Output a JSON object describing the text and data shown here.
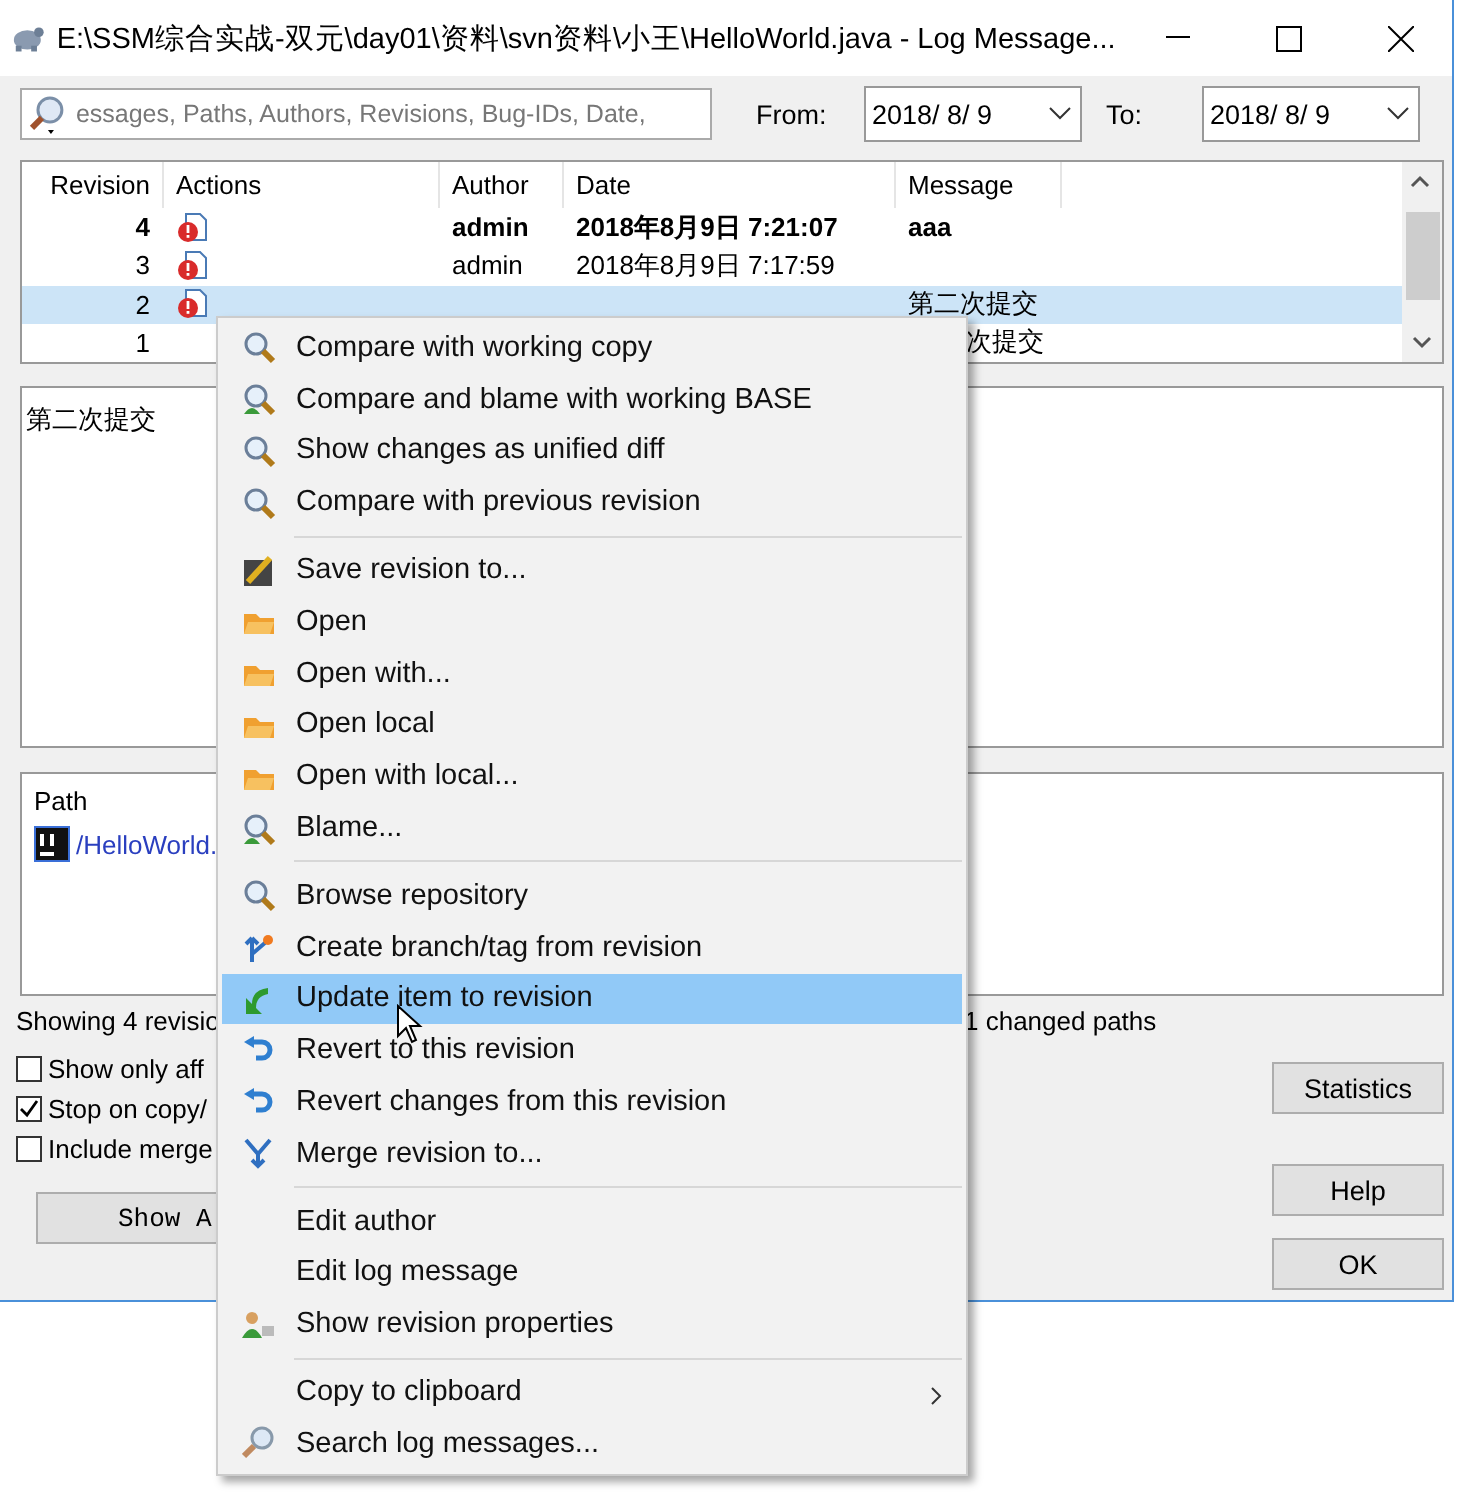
{
  "window": {
    "title": "E:\\SSM综合实战-双元\\day01\\资料\\svn资料\\小王\\HelloWorld.java - Log Message..."
  },
  "filter": {
    "placeholder": "essages, Paths, Authors, Revisions, Bug-IDs, Date,",
    "from_label": "From:",
    "from_value": "2018/ 8/ 9",
    "to_label": "To:",
    "to_value": "2018/ 8/ 9"
  },
  "log": {
    "columns": [
      "Revision",
      "Actions",
      "Author",
      "Date",
      "Message"
    ],
    "rows": [
      {
        "revision": "4",
        "actions": true,
        "author": "admin",
        "date": "2018年8月9日 7:21:07",
        "message": "aaa",
        "current": true,
        "selected": false
      },
      {
        "revision": "3",
        "actions": true,
        "author": "admin",
        "date": "2018年8月9日 7:17:59",
        "current": false,
        "selected": false
      },
      {
        "revision": "2",
        "actions": true,
        "message": "第二次提交",
        "current": false,
        "selected": true
      },
      {
        "revision": "1",
        "actions": false,
        "message_tail": "次提交",
        "current": false,
        "selected": false
      }
    ]
  },
  "message_box": {
    "text": "第二次提交"
  },
  "paths": {
    "header": "Path",
    "items": [
      {
        "path": "/HelloWorld."
      }
    ]
  },
  "status": {
    "left": "Showing 4 revisio",
    "right": "1 changed paths"
  },
  "options": [
    {
      "label": "Show only aff",
      "checked": false
    },
    {
      "label": "Stop on copy/",
      "checked": true
    },
    {
      "label": "Include merge",
      "checked": false
    }
  ],
  "buttons": {
    "show_all": "Show A",
    "statistics": "Statistics",
    "help": "Help",
    "ok": "OK"
  },
  "context_menu": {
    "groups": [
      [
        {
          "label": "Compare with working copy",
          "kind": "compare",
          "selected": false
        },
        {
          "label": "Compare and blame with working BASE",
          "kind": "blame",
          "selected": false
        },
        {
          "label": "Show changes as unified diff",
          "kind": "compare",
          "selected": false
        },
        {
          "label": "Compare with previous revision",
          "kind": "compare",
          "selected": false
        }
      ],
      [
        {
          "label": "Save revision to...",
          "kind": "save",
          "selected": false
        },
        {
          "label": "Open",
          "kind": "open",
          "selected": false
        },
        {
          "label": "Open with...",
          "kind": "open",
          "selected": false
        },
        {
          "label": "Open local",
          "kind": "open",
          "selected": false
        },
        {
          "label": "Open with local...",
          "kind": "open",
          "selected": false
        },
        {
          "label": "Blame...",
          "kind": "blame",
          "selected": false
        }
      ],
      [
        {
          "label": "Browse repository",
          "kind": "browse",
          "selected": false
        },
        {
          "label": "Create branch/tag from revision",
          "kind": "branch",
          "selected": false
        },
        {
          "label": "Update item to revision",
          "kind": "update",
          "selected": true
        },
        {
          "label": "Revert to this revision",
          "kind": "revert",
          "selected": false
        },
        {
          "label": "Revert changes from this revision",
          "kind": "revert",
          "selected": false
        },
        {
          "label": "Merge revision to...",
          "kind": "merge",
          "selected": false
        }
      ],
      [
        {
          "label": "Edit author",
          "kind": "plain",
          "selected": false
        },
        {
          "label": "Edit log message",
          "kind": "plain",
          "selected": false
        },
        {
          "label": "Show revision properties",
          "kind": "props",
          "selected": false
        }
      ],
      [
        {
          "label": "Copy to clipboard",
          "kind": "plain",
          "submenu": true,
          "selected": false
        },
        {
          "label": "Search log messages...",
          "kind": "search",
          "selected": false
        }
      ]
    ]
  }
}
